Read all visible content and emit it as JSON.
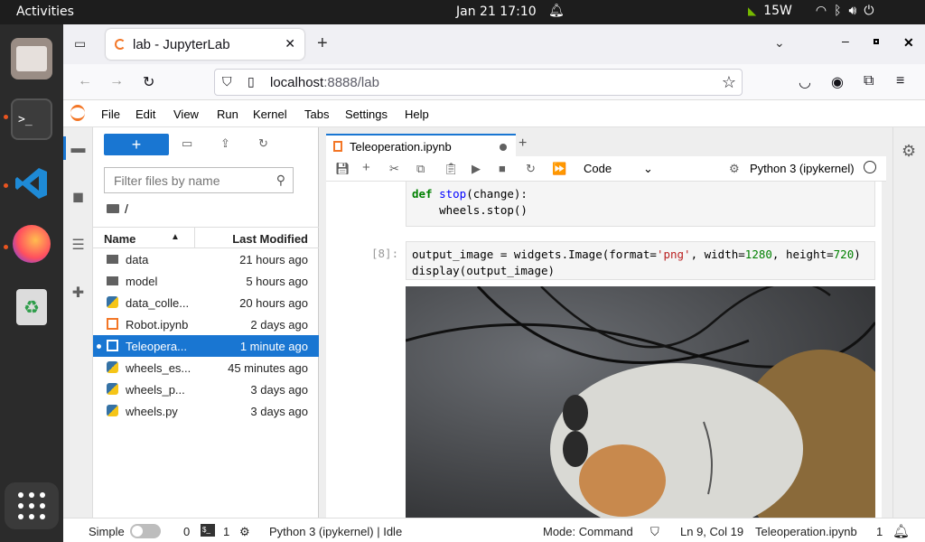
{
  "system": {
    "activities": "Activities",
    "clock": "Jan 21  17:10",
    "power": "15W"
  },
  "browser": {
    "tab_title": "lab - JupyterLab",
    "url_host": "localhost",
    "url_rest": ":8888/lab"
  },
  "menu": {
    "items": [
      "File",
      "Edit",
      "View",
      "Run",
      "Kernel",
      "Tabs",
      "Settings",
      "Help"
    ]
  },
  "filebrowser": {
    "new_label": "+",
    "filter_placeholder": "Filter files by name",
    "breadcrumb": "/",
    "col_name": "Name",
    "col_modified": "Last Modified",
    "files": [
      {
        "name": "data",
        "modified": "21 hours ago",
        "type": "folder"
      },
      {
        "name": "model",
        "modified": "5 hours ago",
        "type": "folder"
      },
      {
        "name": "data_colle...",
        "modified": "20 hours ago",
        "type": "python"
      },
      {
        "name": "Robot.ipynb",
        "modified": "2 days ago",
        "type": "notebook"
      },
      {
        "name": "Teleopera...",
        "modified": "1 minute ago",
        "type": "notebook",
        "selected": true
      },
      {
        "name": "wheels_es...",
        "modified": "45 minutes ago",
        "type": "python"
      },
      {
        "name": "wheels_p...",
        "modified": "3 days ago",
        "type": "python"
      },
      {
        "name": "wheels.py",
        "modified": "3 days ago",
        "type": "python"
      }
    ]
  },
  "notebook": {
    "tab_title": "Teleoperation.ipynb",
    "cell_type": "Code",
    "kernel": "Python 3 (ipykernel)",
    "cell1_line1_kw": "def",
    "cell1_line1_fn": "stop",
    "cell1_line1_rest": "(change):",
    "cell1_line2": "    wheels.stop()",
    "cell2_prompt": "[8]:",
    "cell2_line1_a": "output_image = widgets.Image(format=",
    "cell2_line1_str": "'png'",
    "cell2_line1_b": ", width=",
    "cell2_line1_n1": "1280",
    "cell2_line1_c": ", height=",
    "cell2_line1_n2": "720",
    "cell2_line1_d": ")",
    "cell2_line2": "display(output_image)"
  },
  "status": {
    "mode_toggle": "Simple",
    "terminals": "0",
    "kernels": "1",
    "kernel_status": "Python 3 (ipykernel) | Idle",
    "mode": "Mode: Command",
    "position": "Ln 9, Col 19",
    "file": "Teleoperation.ipynb",
    "notifications": "1"
  },
  "colors": {
    "accent": "#1976d2",
    "jupyter_orange": "#f37626",
    "ubuntu_orange": "#e95420"
  }
}
